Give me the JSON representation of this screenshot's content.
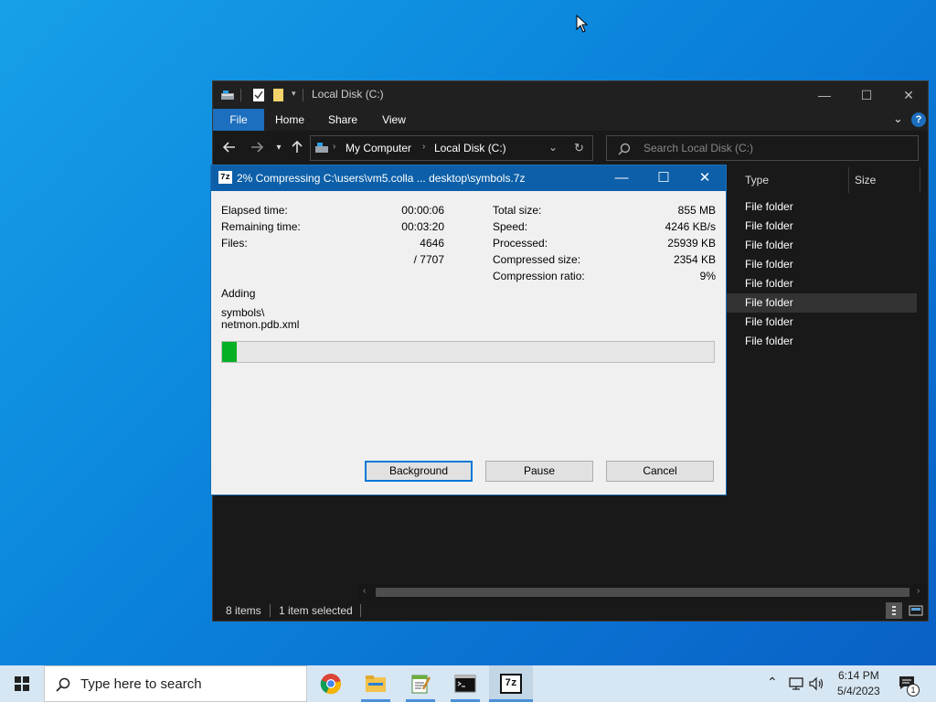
{
  "explorer": {
    "title": "Local Disk (C:)",
    "ribbon_tabs": [
      "File",
      "Home",
      "Share",
      "View"
    ],
    "address": {
      "crumbs": [
        "My Computer",
        "Local Disk (C:)"
      ]
    },
    "search_placeholder": "Search Local Disk (C:)",
    "columns": [
      "Type",
      "Size"
    ],
    "rows": [
      "File folder",
      "File folder",
      "File folder",
      "File folder",
      "File folder",
      "File folder",
      "File folder",
      "File folder"
    ],
    "selected_row_index": 5,
    "status": {
      "items": "8 items",
      "selected": "1 item selected"
    },
    "help_glyph": "?"
  },
  "dialog": {
    "title": "2% Compressing C:\\users\\vm5.colla ... desktop\\symbols.7z",
    "icon_text": "7z",
    "left_stats": [
      {
        "label": "Elapsed time:",
        "value": "00:00:06"
      },
      {
        "label": "Remaining time:",
        "value": "00:03:20"
      },
      {
        "label": "Files:",
        "value": "4646"
      },
      {
        "label": "",
        "value": "/ 7707"
      }
    ],
    "right_stats": [
      {
        "label": "Total size:",
        "value": "855 MB"
      },
      {
        "label": "Speed:",
        "value": "4246 KB/s"
      },
      {
        "label": "Processed:",
        "value": "25939 KB"
      },
      {
        "label": "Compressed size:",
        "value": "2354 KB"
      },
      {
        "label": "Compression ratio:",
        "value": "9%"
      }
    ],
    "action": "Adding",
    "current_dir": "symbols\\",
    "current_file": "netmon.pdb.xml",
    "progress_percent": 2,
    "buttons": {
      "background": "Background",
      "pause": "Pause",
      "cancel": "Cancel"
    }
  },
  "taskbar": {
    "search_placeholder": "Type here to search",
    "time": "6:14 PM",
    "date": "5/4/2023",
    "notification_count": "1",
    "apps": [
      "chrome-icon",
      "file-explorer-icon",
      "notepad-icon",
      "cmd-icon",
      "7zip-icon"
    ]
  },
  "colors": {
    "accent": "#0c5fa8",
    "progress": "#06b025",
    "file_tab": "#1c6ebe"
  }
}
